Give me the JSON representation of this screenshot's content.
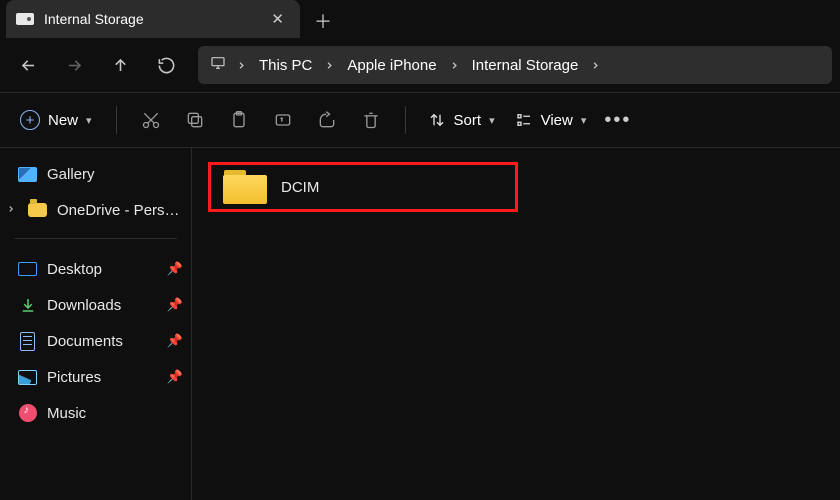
{
  "tab": {
    "title": "Internal Storage"
  },
  "breadcrumb": {
    "items": [
      "This PC",
      "Apple iPhone",
      "Internal Storage"
    ]
  },
  "toolbar": {
    "new_label": "New",
    "sort_label": "Sort",
    "view_label": "View"
  },
  "sidebar": {
    "top": [
      {
        "label": "Gallery",
        "icon": "gallery"
      },
      {
        "label": "OneDrive - Personal",
        "icon": "onedrive",
        "expandable": true
      }
    ],
    "quick": [
      {
        "label": "Desktop",
        "icon": "desktop",
        "pinned": true
      },
      {
        "label": "Downloads",
        "icon": "download",
        "pinned": true
      },
      {
        "label": "Documents",
        "icon": "docs",
        "pinned": true
      },
      {
        "label": "Pictures",
        "icon": "pics",
        "pinned": true
      },
      {
        "label": "Music",
        "icon": "music",
        "pinned": false
      }
    ]
  },
  "content": {
    "items": [
      {
        "name": "DCIM",
        "type": "folder",
        "highlighted": true
      }
    ]
  }
}
